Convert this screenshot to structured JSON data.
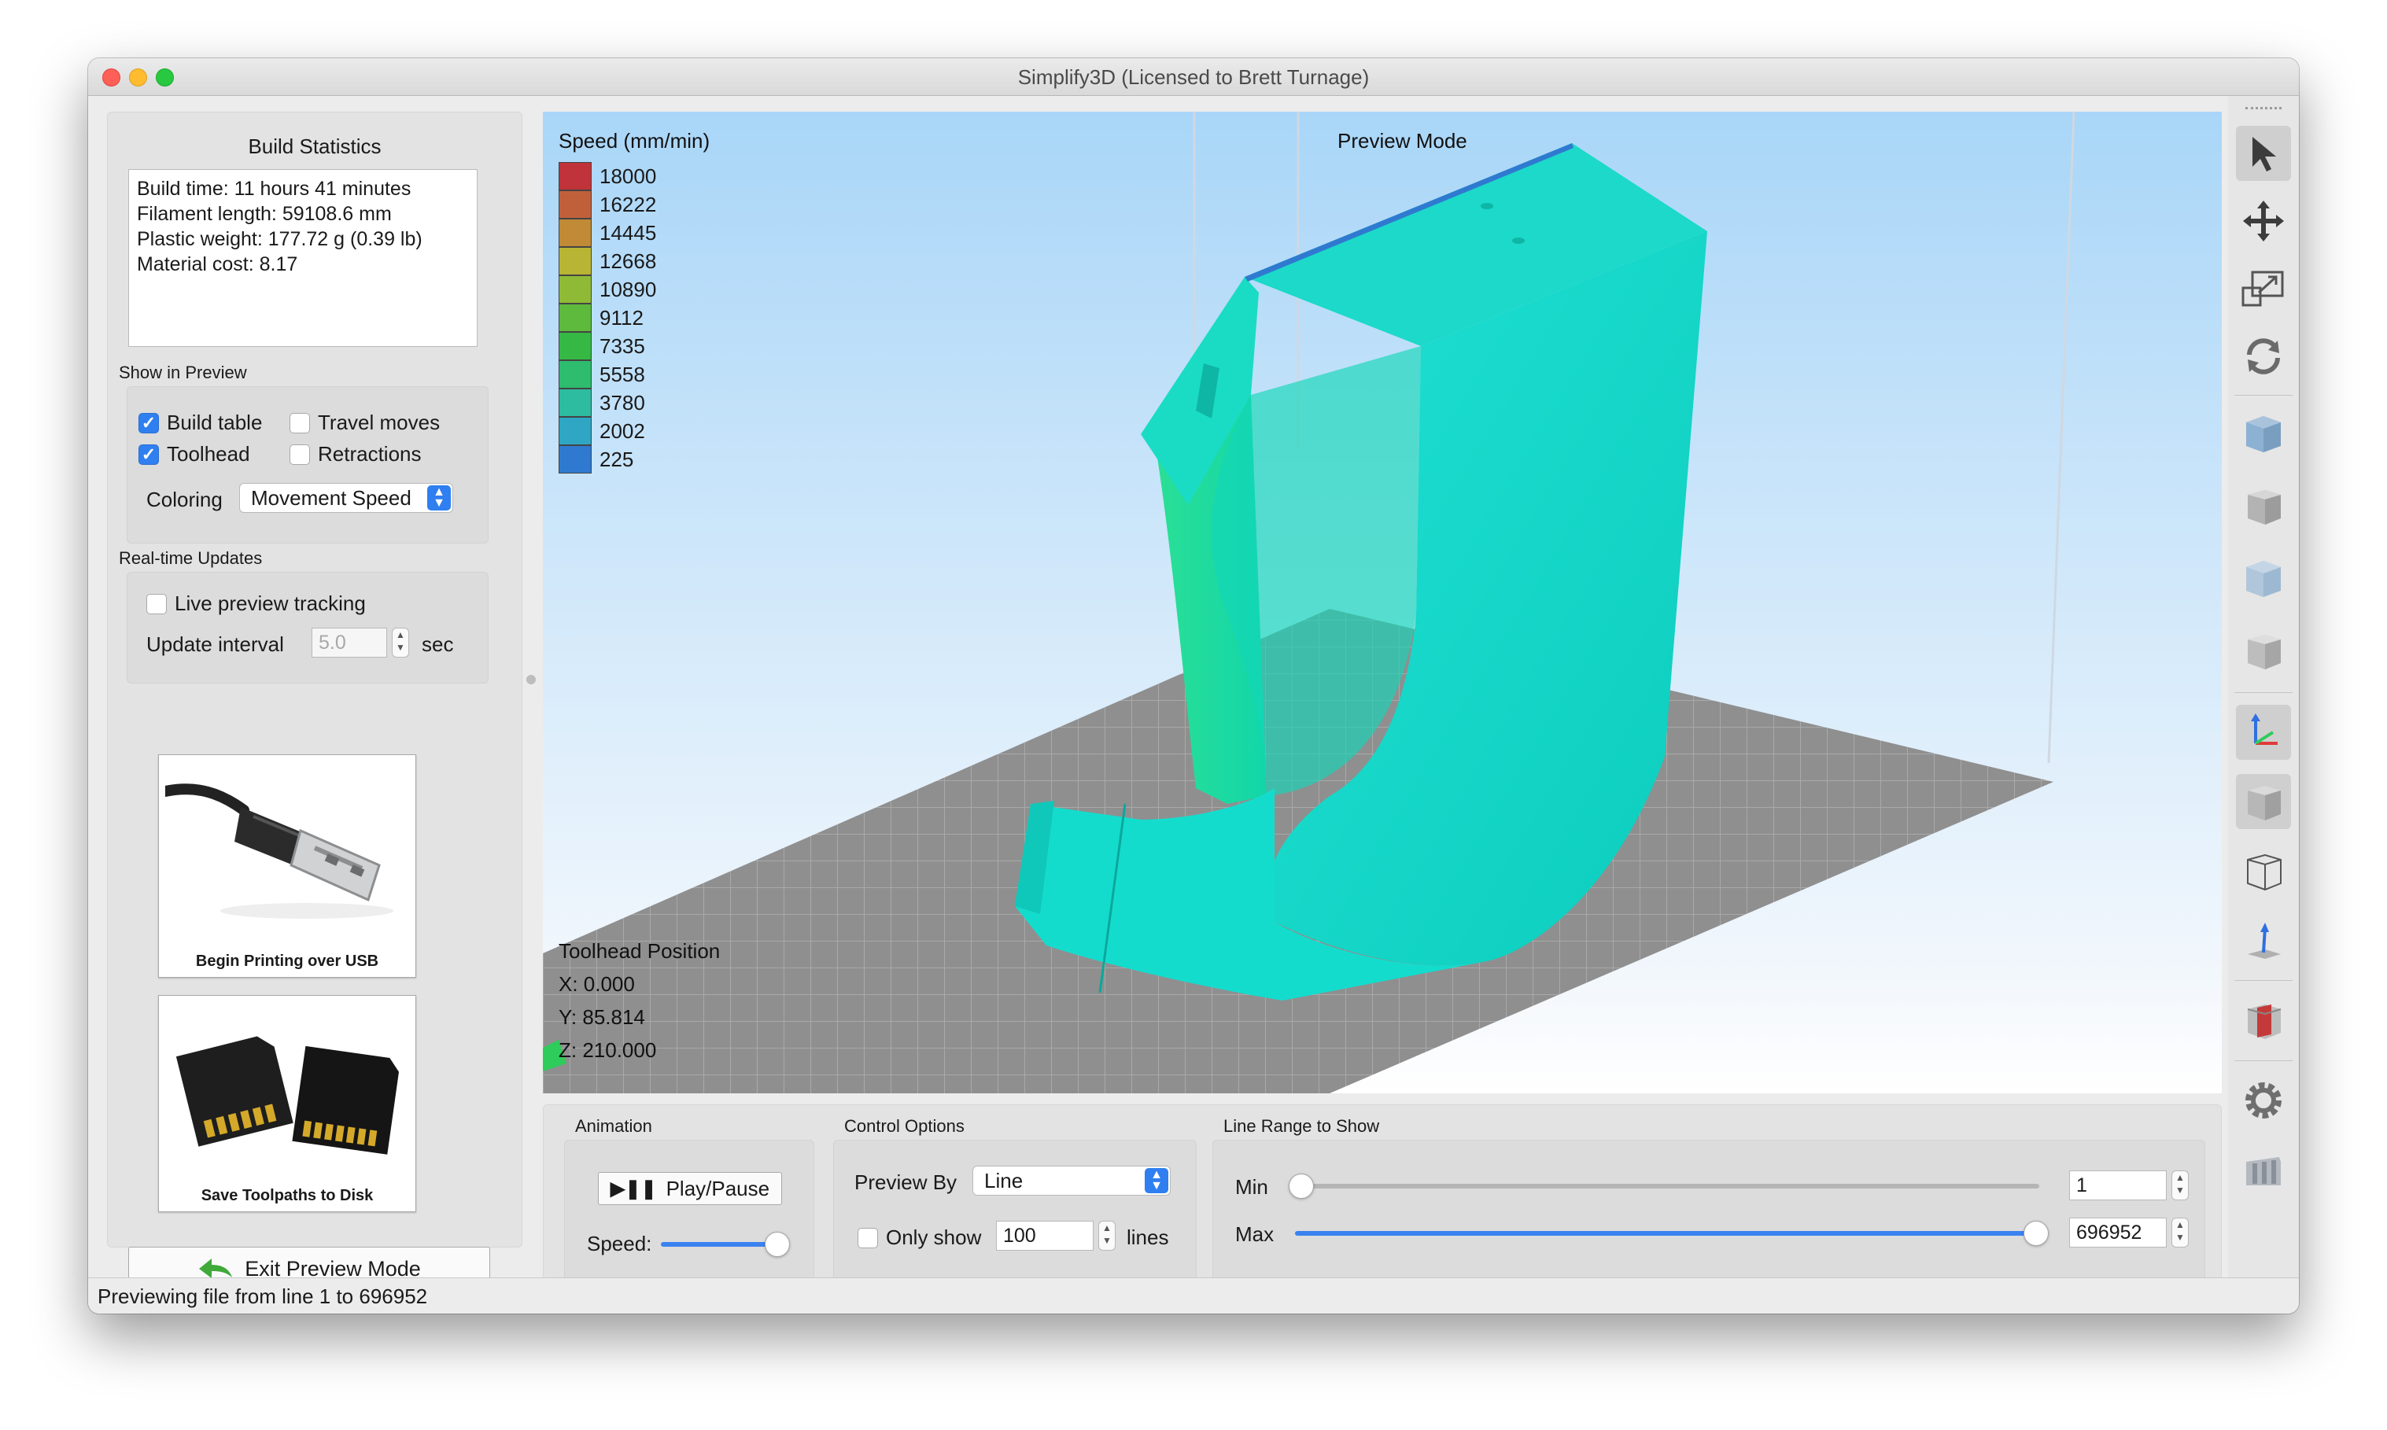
{
  "window": {
    "title": "Simplify3D (Licensed to Brett Turnage)"
  },
  "build_stats": {
    "title": "Build Statistics",
    "lines": [
      "Build time: 11 hours 41 minutes",
      "Filament length: 59108.6 mm",
      "Plastic weight: 177.72 g (0.39 lb)",
      "Material cost: 8.17"
    ]
  },
  "show_in_preview": {
    "label": "Show in Preview",
    "build_table": {
      "label": "Build table",
      "checked": true
    },
    "travel_moves": {
      "label": "Travel moves",
      "checked": false
    },
    "toolhead": {
      "label": "Toolhead",
      "checked": true
    },
    "retractions": {
      "label": "Retractions",
      "checked": false
    },
    "coloring_label": "Coloring",
    "coloring_value": "Movement Speed"
  },
  "realtime": {
    "label": "Real-time Updates",
    "live_tracking": {
      "label": "Live preview tracking",
      "checked": false
    },
    "interval_label": "Update interval",
    "interval_value": "5.0",
    "interval_unit": "sec"
  },
  "usb_button": {
    "caption": "Begin Printing over USB"
  },
  "disk_button": {
    "caption": "Save Toolpaths to Disk"
  },
  "exit_button": {
    "label": "Exit Preview Mode"
  },
  "viewport": {
    "mode_label": "Preview Mode",
    "legend_title": "Speed (mm/min)",
    "legend": [
      {
        "value": "18000",
        "color": "#c0333a"
      },
      {
        "value": "16222",
        "color": "#c0603a"
      },
      {
        "value": "14445",
        "color": "#c08a36"
      },
      {
        "value": "12668",
        "color": "#b9b534"
      },
      {
        "value": "10890",
        "color": "#8fba36"
      },
      {
        "value": "9112",
        "color": "#5dba3c"
      },
      {
        "value": "7335",
        "color": "#36b845"
      },
      {
        "value": "5558",
        "color": "#2ebc6f"
      },
      {
        "value": "3780",
        "color": "#2ebca0"
      },
      {
        "value": "2002",
        "color": "#2ea6c4"
      },
      {
        "value": "225",
        "color": "#2f7ad0"
      }
    ],
    "toolhead": {
      "title": "Toolhead Position",
      "x": "X: 0.000",
      "y": "Y: 85.814",
      "z": "Z: 210.000"
    },
    "model_color": "#12dccb"
  },
  "animation": {
    "label": "Animation",
    "play_label": "Play/Pause",
    "speed_label": "Speed:",
    "speed_level": 1.0
  },
  "control_options": {
    "label": "Control Options",
    "preview_by_label": "Preview By",
    "preview_by_value": "Line",
    "only_show": {
      "label": "Only show",
      "checked": false
    },
    "only_show_value": "100",
    "only_show_unit": "lines"
  },
  "line_range": {
    "label": "Line Range to Show",
    "min_label": "Min",
    "min_value": "1",
    "max_label": "Max",
    "max_value": "696952"
  },
  "status": {
    "text": "Previewing file from line 1 to 696952"
  },
  "toolbar": {
    "icons": [
      "select-icon",
      "move-icon",
      "scale-icon",
      "rotate-icon",
      "view-iso-icon",
      "view-front-icon",
      "view-top-icon",
      "view-side-icon",
      "axes-icon",
      "solid-view-icon",
      "wireframe-icon",
      "normals-icon",
      "cross-section-icon",
      "settings-icon",
      "machine-icon"
    ]
  }
}
